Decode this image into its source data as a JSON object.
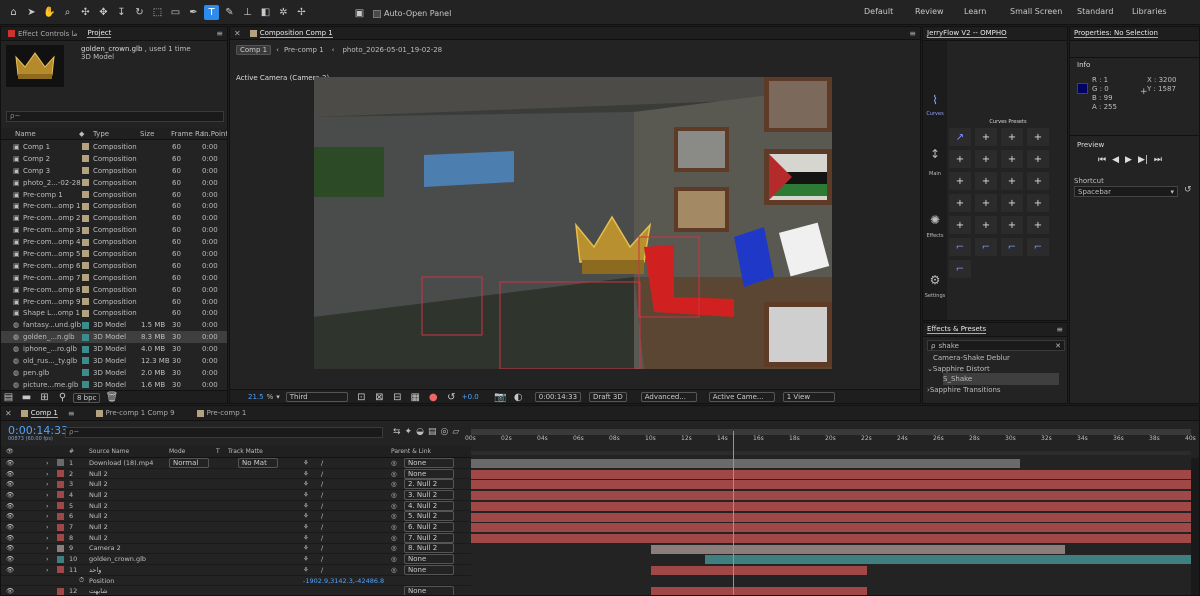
{
  "toolbar": {
    "auto_open_label": "Auto-Open Panel",
    "workspaces": [
      "Default",
      "Review",
      "Learn",
      "Small Screen",
      "Standard",
      "Libraries"
    ]
  },
  "project": {
    "tabs": [
      "Effect Controls ما",
      "Project"
    ],
    "asset_name": "golden_crown.glb",
    "asset_used": ", used 1 time",
    "asset_type": "3D Model",
    "search_placeholder": "ρ~",
    "columns": [
      "Name",
      "Type",
      "Size",
      "Frame Ra...",
      "In Point"
    ],
    "items": [
      {
        "name": "Comp 1",
        "type": "Composition",
        "size": "",
        "fps": "60",
        "in": "0:00"
      },
      {
        "name": "Comp 2",
        "type": "Composition",
        "size": "",
        "fps": "60",
        "in": "0:00"
      },
      {
        "name": "Comp 3",
        "type": "Composition",
        "size": "",
        "fps": "60",
        "in": "0:00"
      },
      {
        "name": "photo_2...-02-28",
        "type": "Composition",
        "size": "",
        "fps": "60",
        "in": "0:00"
      },
      {
        "name": "Pre-comp 1",
        "type": "Composition",
        "size": "",
        "fps": "60",
        "in": "0:00"
      },
      {
        "name": "Pre-com...omp 1",
        "type": "Composition",
        "size": "",
        "fps": "60",
        "in": "0:00"
      },
      {
        "name": "Pre-com...omp 2",
        "type": "Composition",
        "size": "",
        "fps": "60",
        "in": "0:00"
      },
      {
        "name": "Pre-com...omp 3",
        "type": "Composition",
        "size": "",
        "fps": "60",
        "in": "0:00"
      },
      {
        "name": "Pre-com...omp 4",
        "type": "Composition",
        "size": "",
        "fps": "60",
        "in": "0:00"
      },
      {
        "name": "Pre-com...omp 5",
        "type": "Composition",
        "size": "",
        "fps": "60",
        "in": "0:00"
      },
      {
        "name": "Pre-com...omp 6",
        "type": "Composition",
        "size": "",
        "fps": "60",
        "in": "0:00"
      },
      {
        "name": "Pre-com...omp 7",
        "type": "Composition",
        "size": "",
        "fps": "60",
        "in": "0:00"
      },
      {
        "name": "Pre-com...omp 8",
        "type": "Composition",
        "size": "",
        "fps": "60",
        "in": "0:00"
      },
      {
        "name": "Pre-com...omp 9",
        "type": "Composition",
        "size": "",
        "fps": "60",
        "in": "0:00"
      },
      {
        "name": "Shape L...omp 1",
        "type": "Composition",
        "size": "",
        "fps": "60",
        "in": "0:00"
      },
      {
        "name": "fantasy...und.glb",
        "type": "3D Model",
        "size": "1.5 MB",
        "fps": "30",
        "in": "0:00"
      },
      {
        "name": "golden_...n.glb",
        "type": "3D Model",
        "size": "8.3 MB",
        "fps": "30",
        "in": "0:00"
      },
      {
        "name": "iphone_...ro.glb",
        "type": "3D Model",
        "size": "4.0 MB",
        "fps": "30",
        "in": "0:00"
      },
      {
        "name": "old_rus..._ty.glb",
        "type": "3D Model",
        "size": "12.3 MB",
        "fps": "30",
        "in": "0:00"
      },
      {
        "name": "pen.glb",
        "type": "3D Model",
        "size": "2.0 MB",
        "fps": "30",
        "in": "0:00"
      },
      {
        "name": "picture...me.glb",
        "type": "3D Model",
        "size": "1.6 MB",
        "fps": "30",
        "in": "0:00"
      }
    ],
    "bpc": "8 bpc"
  },
  "composition": {
    "panel_title": "Composition Comp 1",
    "crumbs": [
      "Comp 1",
      "Pre-comp 1",
      "photo_2026-05-01_19-02-28"
    ],
    "camera_label": "Active Camera (Camera 2)",
    "zoom": "21.5",
    "zoom_unit": "%",
    "resolution": "Third",
    "exposure": "+0.0",
    "timecode": "0:00:14:33",
    "renderer": "Draft 3D",
    "advanced": "Advanced...",
    "camera_select": "Active Came...",
    "view_select": "1 View"
  },
  "jerryflow": {
    "title": "JerryFlow V2 -- OMPHO",
    "side_labels": [
      "Curves",
      "Main",
      "Effects",
      "Settings"
    ],
    "presets_label": "Curves Presets",
    "presets": [
      "↗",
      "+",
      "+",
      "+",
      "+",
      "+",
      "+",
      "+",
      "+",
      "+",
      "+",
      "+",
      "+",
      "+",
      "+",
      "+",
      "+",
      "+",
      "+",
      "+",
      "⌐",
      "⌐",
      "⌐",
      "⌐",
      "⌐"
    ]
  },
  "effects": {
    "title": "Effects & Presets",
    "search": "shake",
    "items": [
      "Camera-Shake Deblur",
      "Sapphire Distort",
      "S_Shake",
      "Sapphire Transitions"
    ]
  },
  "properties": {
    "title": "Properties: No Selection",
    "info_title": "Info",
    "r": "R : 1",
    "g": "G : 0",
    "b": "B : 99",
    "a": "A : 255",
    "x": "X : 3200",
    "y": "Y : 1587",
    "preview_title": "Preview",
    "shortcut_label": "Shortcut",
    "shortcut_value": "Spacebar",
    "swatch_color": "#010163"
  },
  "timeline": {
    "tabs": [
      "Comp 1",
      "Pre-comp 1 Comp 9",
      "Pre-comp 1"
    ],
    "timecode": "0:00:14:33",
    "frames": "00873 (60.00 fps)",
    "search_placeholder": "ρ~",
    "columns": [
      "Source Name",
      "Mode",
      "T",
      "Track Matte",
      "Parent & Link"
    ],
    "ruler": [
      "00s",
      "02s",
      "04s",
      "06s",
      "08s",
      "10s",
      "12s",
      "14s",
      "16s",
      "18s",
      "20s",
      "22s",
      "24s",
      "26s",
      "28s",
      "30s",
      "32s",
      "34s",
      "36s",
      "38s",
      "40s"
    ],
    "playhead_seconds": 14.55,
    "duration_seconds": 40,
    "layers": [
      {
        "num": "1",
        "name": "Download (18).mp4",
        "mode": "Normal",
        "matte": "No Mat",
        "parent": "None",
        "color": "#6a6a6a",
        "start": 0,
        "end": 30.5
      },
      {
        "num": "2",
        "name": "Null 2",
        "mode": "",
        "matte": "",
        "parent": "None",
        "color": "#a04848",
        "start": 0,
        "end": 40
      },
      {
        "num": "3",
        "name": "Null 2",
        "mode": "",
        "matte": "",
        "parent": "2. Null 2",
        "color": "#a04848",
        "start": 0,
        "end": 40
      },
      {
        "num": "4",
        "name": "Null 2",
        "mode": "",
        "matte": "",
        "parent": "3. Null 2",
        "color": "#a04848",
        "start": 0,
        "end": 40
      },
      {
        "num": "5",
        "name": "Null 2",
        "mode": "",
        "matte": "",
        "parent": "4. Null 2",
        "color": "#a04848",
        "start": 0,
        "end": 40
      },
      {
        "num": "6",
        "name": "Null 2",
        "mode": "",
        "matte": "",
        "parent": "5. Null 2",
        "color": "#a04848",
        "start": 0,
        "end": 40
      },
      {
        "num": "7",
        "name": "Null 2",
        "mode": "",
        "matte": "",
        "parent": "6. Null 2",
        "color": "#a04848",
        "start": 0,
        "end": 40
      },
      {
        "num": "8",
        "name": "Null 2",
        "mode": "",
        "matte": "",
        "parent": "7. Null 2",
        "color": "#a04848",
        "start": 0,
        "end": 40
      },
      {
        "num": "9",
        "name": "Camera 2",
        "mode": "",
        "matte": "",
        "parent": "8. Null 2",
        "color": "#8c7d7d",
        "start": 10,
        "end": 33
      },
      {
        "num": "10",
        "name": "golden_crown.glb",
        "mode": "",
        "matte": "",
        "parent": "None",
        "color": "#3f7f7f",
        "start": 13,
        "end": 40
      },
      {
        "num": "11",
        "name": "واحد",
        "mode": "",
        "matte": "",
        "parent": "None",
        "color": "#a04848",
        "start": 10,
        "end": 22
      }
    ],
    "position_label": "Position",
    "position_value": "-1902.9,3142.3,-42486.8",
    "layer12": {
      "num": "12",
      "name": "شابهت",
      "parent": "None"
    }
  }
}
